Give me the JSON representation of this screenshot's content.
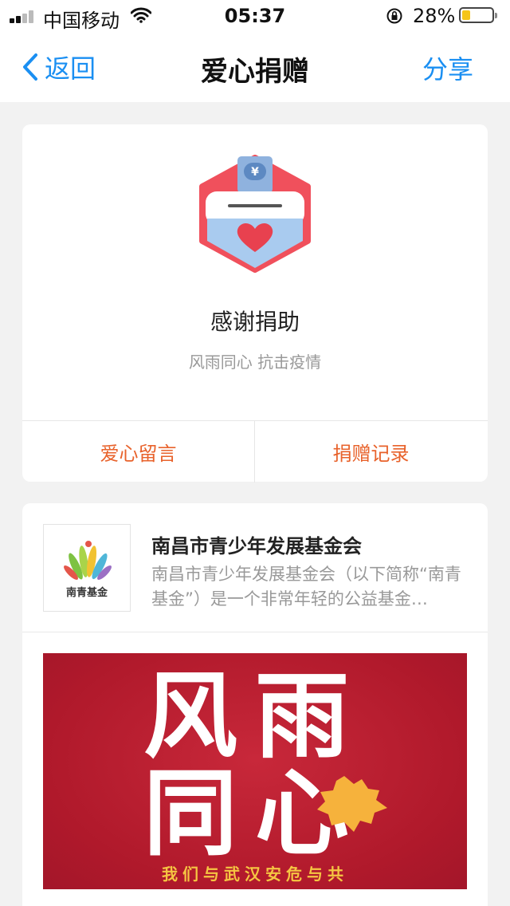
{
  "status_bar": {
    "carrier": "中国移动",
    "time": "05:37",
    "battery_percent": "28%",
    "battery_level": 0.28
  },
  "nav": {
    "back_label": "返回",
    "title": "爱心捐赠",
    "share_label": "分享"
  },
  "donation": {
    "title": "感谢捐助",
    "subtitle": "风雨同心 抗击疫情",
    "actions": [
      "爱心留言",
      "捐赠记录"
    ]
  },
  "organization": {
    "name": "南昌市青少年发展基金会",
    "description": "南昌市青少年发展基金会（以下简称“南青基金”）是一个非常年轻的公益基金…",
    "logo_text": "南青基金"
  },
  "banner": {
    "line1": "风雨",
    "line2": "同心",
    "slogan": "我们与武汉安危与共"
  },
  "colors": {
    "accent_blue": "#1a8ff2",
    "action_orange": "#e8622b",
    "banner_red": "#b0192b",
    "badge_red": "#f0505c",
    "badge_blue": "#a9cbef"
  }
}
